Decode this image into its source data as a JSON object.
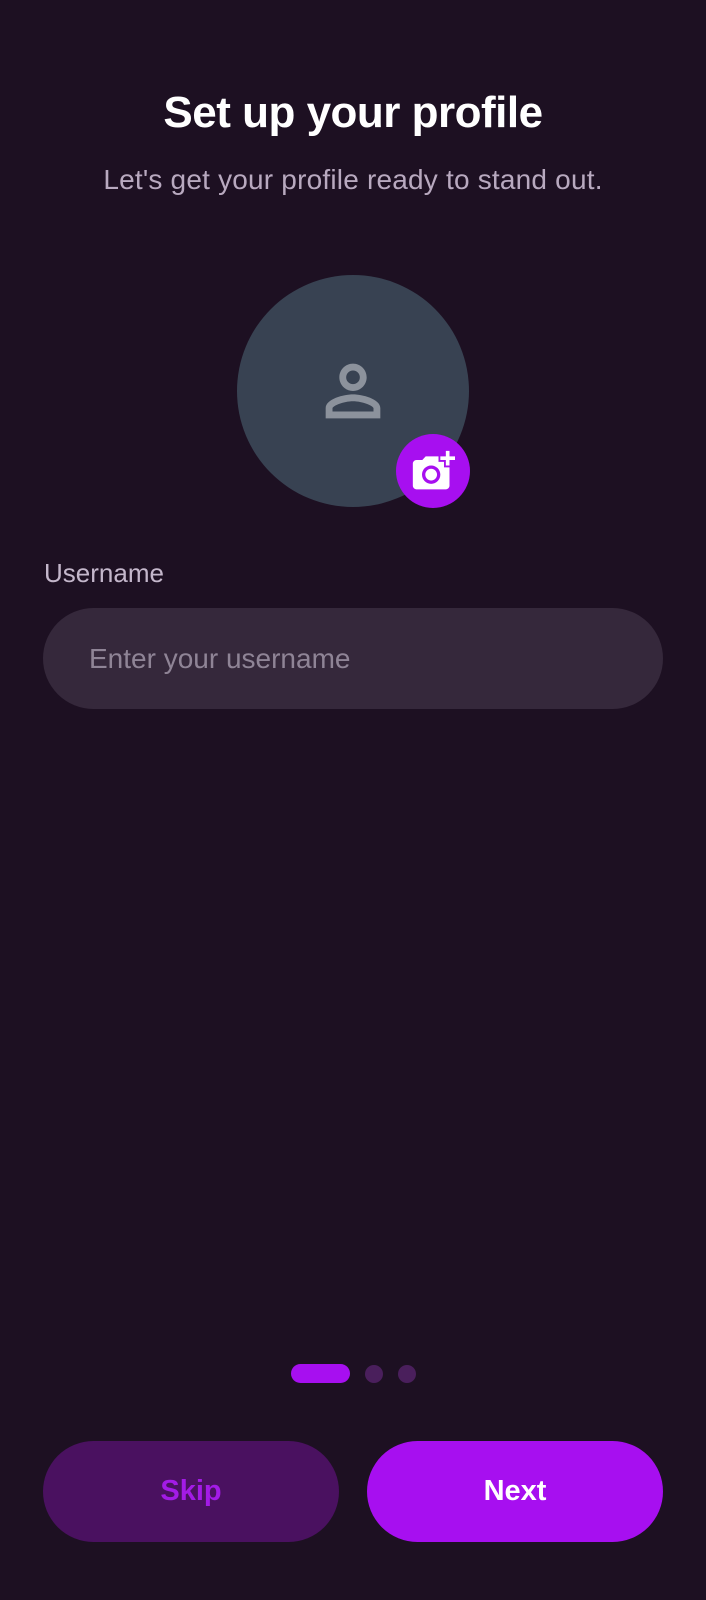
{
  "header": {
    "title": "Set up your profile",
    "subtitle": "Let's get your profile ready to stand out."
  },
  "avatar": {
    "placeholder_icon": "person-icon",
    "action_icon": "add-photo-icon"
  },
  "username": {
    "label": "Username",
    "value": "",
    "placeholder": "Enter your username"
  },
  "pager": {
    "total_steps": 3,
    "current_step": 1
  },
  "actions": {
    "skip_label": "Skip",
    "next_label": "Next"
  },
  "colors": {
    "background": "#1d1022",
    "accent": "#a70ff0",
    "avatar_bg": "#384252",
    "input_bg": "#35283b",
    "skip_bg": "#4a1160",
    "inactive_dot": "#4a1f5c"
  }
}
